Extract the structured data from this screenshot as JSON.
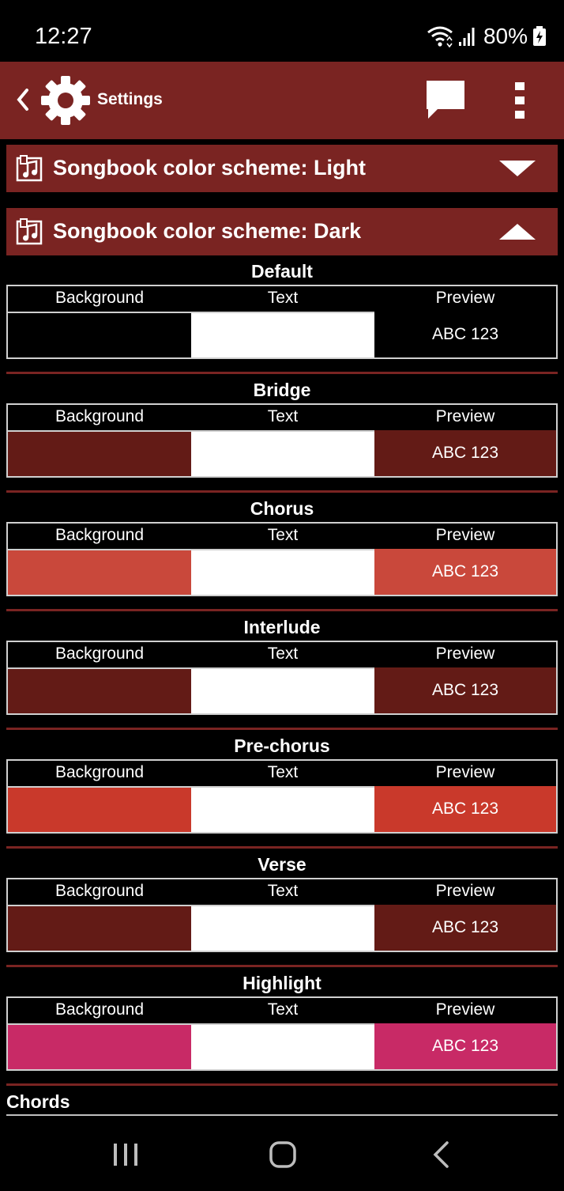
{
  "status_bar": {
    "time": "12:27",
    "battery": "80%"
  },
  "app_bar": {
    "title": "Settings",
    "icons": [
      "back-chevron-icon",
      "gear-icon",
      "chat-bubble-icon",
      "more-vert-icon"
    ]
  },
  "schemes": [
    {
      "title": "Songbook color scheme: Light",
      "expanded": false
    },
    {
      "title": "Songbook color scheme: Dark",
      "expanded": true
    }
  ],
  "columns": {
    "background": "Background",
    "text": "Text",
    "preview": "Preview"
  },
  "sections": [
    {
      "title": "Default",
      "background": "#000000",
      "text_color": "#ffffff",
      "preview": "ABC 123"
    },
    {
      "title": "Bridge",
      "background": "#631b16",
      "text_color": "#ffffff",
      "preview": "ABC 123"
    },
    {
      "title": "Chorus",
      "background": "#c9483b",
      "text_color": "#ffffff",
      "preview": "ABC 123"
    },
    {
      "title": "Interlude",
      "background": "#631b16",
      "text_color": "#ffffff",
      "preview": "ABC 123"
    },
    {
      "title": "Pre-chorus",
      "background": "#c9392b",
      "text_color": "#ffffff",
      "preview": "ABC 123"
    },
    {
      "title": "Verse",
      "background": "#631b16",
      "text_color": "#ffffff",
      "preview": "ABC 123"
    },
    {
      "title": "Highlight",
      "background": "#c82a66",
      "text_color": "#ffffff",
      "preview": "ABC 123"
    }
  ],
  "chords_label": "Chords",
  "colors": {
    "app_bar": "#7a2422",
    "divider": "#7a2422"
  },
  "nav_icons": [
    "recents-icon",
    "home-icon",
    "back-icon"
  ]
}
